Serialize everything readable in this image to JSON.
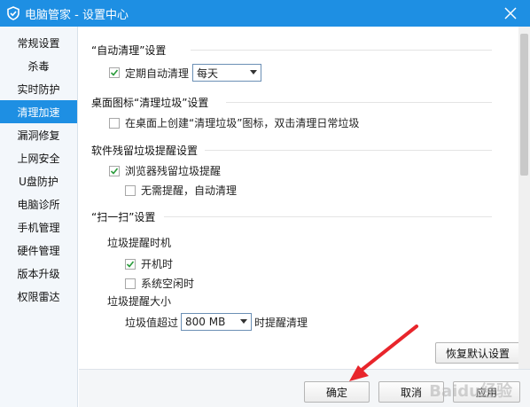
{
  "window": {
    "title": "电脑管家 - 设置中心"
  },
  "sidebar": {
    "items": [
      {
        "label": "常规设置",
        "active": false
      },
      {
        "label": "杀毒",
        "active": false
      },
      {
        "label": "实时防护",
        "active": false
      },
      {
        "label": "清理加速",
        "active": true
      },
      {
        "label": "漏洞修复",
        "active": false
      },
      {
        "label": "上网安全",
        "active": false
      },
      {
        "label": "U盘防护",
        "active": false
      },
      {
        "label": "电脑诊所",
        "active": false
      },
      {
        "label": "手机管理",
        "active": false
      },
      {
        "label": "硬件管理",
        "active": false
      },
      {
        "label": "版本升级",
        "active": false
      },
      {
        "label": "权限雷达",
        "active": false
      }
    ]
  },
  "sections": {
    "auto_clean": {
      "title": "“自动清理”设置",
      "option_label": "定期自动清理",
      "option_checked": true,
      "frequency_value": "每天"
    },
    "desktop_icon": {
      "title": "桌面图标“清理垃圾”设置",
      "option_label": "在桌面上创建“清理垃圾”图标，双击清理日常垃圾",
      "option_checked": false
    },
    "residual": {
      "title": "软件残留垃圾提醒设置",
      "option_label": "浏览器残留垃圾提醒",
      "option_checked": true,
      "sub_option_label": "无需提醒，自动清理",
      "sub_option_checked": false
    },
    "scan": {
      "title": "“扫一扫”设置",
      "reminder_time_label": "垃圾提醒时机",
      "on_boot_label": "开机时",
      "on_boot_checked": true,
      "on_idle_label": "系统空闲时",
      "on_idle_checked": false,
      "reminder_size_label": "垃圾提醒大小",
      "threshold_prefix": "垃圾值超过",
      "threshold_value": "800 MB",
      "threshold_suffix": "时提醒清理"
    }
  },
  "buttons": {
    "restore_defaults": "恢复默认设置",
    "ok": "确定",
    "cancel": "取消",
    "apply": "应用"
  },
  "watermark": "Baidu经验",
  "colors": {
    "accent": "#1e8fe3",
    "annotation_arrow": "#e8252b"
  }
}
